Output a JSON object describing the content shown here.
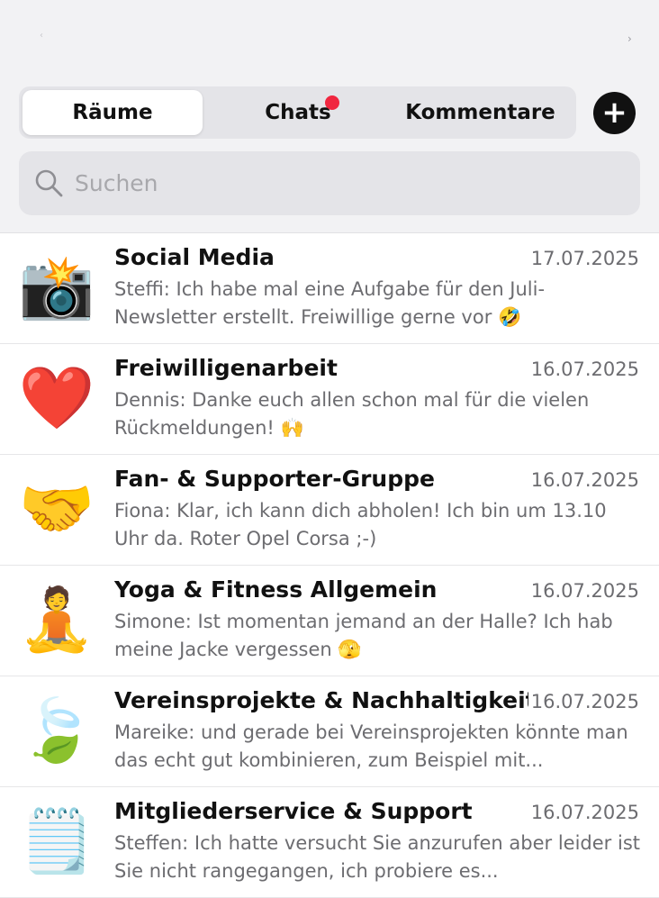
{
  "tabs": [
    {
      "label": "Räume",
      "active": true
    },
    {
      "label": "Chats",
      "active": false,
      "has_badge": true
    },
    {
      "label": "Kommentare",
      "active": false
    }
  ],
  "add_button": {
    "label": "+"
  },
  "search": {
    "placeholder": "Suchen"
  },
  "colors": {
    "header_bg": "#f2f2f4",
    "segment_bg": "#e4e4e8",
    "badge": "#f0263f",
    "text_primary": "#111111",
    "text_secondary": "#6c6c70"
  },
  "rooms": [
    {
      "avatar_emoji": "📸",
      "name": "Social Media",
      "date": "17.07.2025",
      "preview": "Steffi: Ich habe mal eine Aufgabe für den Juli-Newsletter erstellt. Freiwillige gerne vor 🤣"
    },
    {
      "avatar_emoji": "❤️",
      "name": "Freiwilligenarbeit",
      "date": "16.07.2025",
      "preview": "Dennis: Danke euch allen schon mal für die vielen Rückmeldungen! 🙌"
    },
    {
      "avatar_emoji": "🤝",
      "name": "Fan- & Supporter-Gruppe",
      "date": "16.07.2025",
      "preview": "Fiona: Klar, ich kann dich abholen! Ich bin um 13.10 Uhr da. Roter Opel Corsa ;-)"
    },
    {
      "avatar_emoji": "🧘",
      "name": "Yoga & Fitness Allgemein",
      "date": "16.07.2025",
      "preview": "Simone: Ist momentan jemand an der Halle? Ich hab meine Jacke vergessen 🫣"
    },
    {
      "avatar_emoji": "🍃",
      "name": "Vereinsprojekte & Nachhaltigkeit",
      "date": "16.07.2025",
      "preview": "Mareike: und gerade bei Vereinsprojekten könnte man das echt gut kombinieren, zum Beispiel mit..."
    },
    {
      "avatar_emoji": "🗒️",
      "name": "Mitgliederservice & Support",
      "date": "16.07.2025",
      "preview": "Steffen: Ich hatte versucht Sie anzurufen aber leider ist Sie nicht rangegangen, ich probiere es..."
    }
  ]
}
